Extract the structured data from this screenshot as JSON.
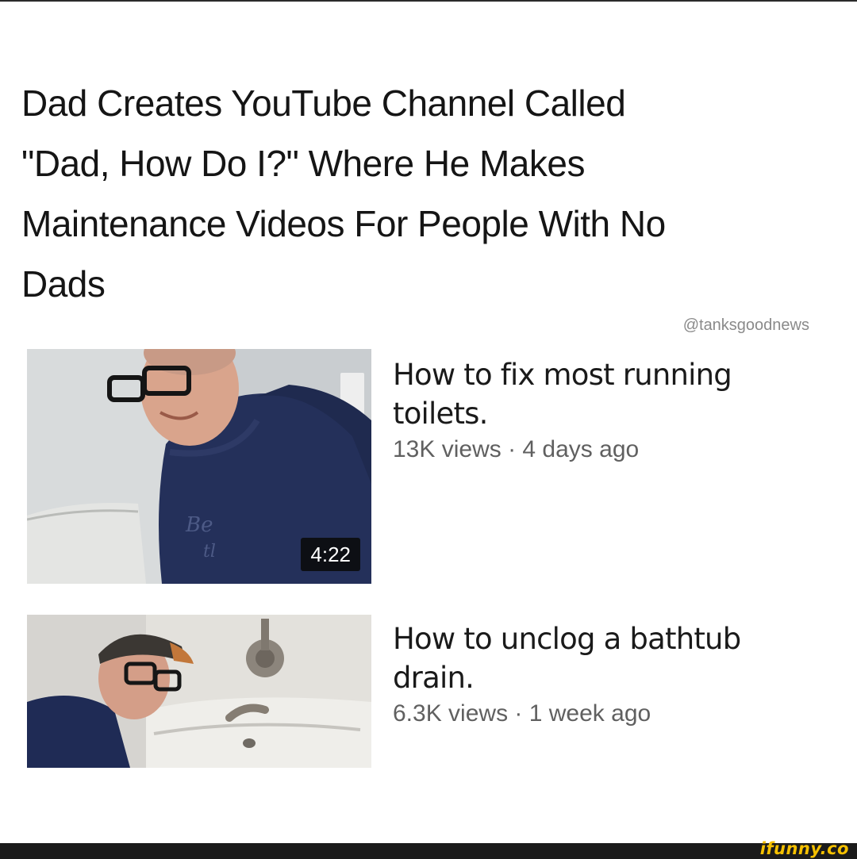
{
  "headline": {
    "line1": "Dad Creates YouTube Channel Called",
    "line2": "\"Dad, How Do I?\" Where He Makes",
    "line3": "Maintenance Videos For People With No",
    "line4": "Dads"
  },
  "credit": "@tanksgoodnews",
  "videos": [
    {
      "title_line1": "How to fix most running",
      "title_line2": "toilets.",
      "views": "13K views",
      "separator": " · ",
      "age": "4 days ago",
      "duration": "4:22"
    },
    {
      "title_line1": "How to unclog a bathtub",
      "title_line2": "drain.",
      "views": "6.3K views",
      "separator": " · ",
      "age": "1 week ago"
    }
  ],
  "watermark": "ifunny.co",
  "colors": {
    "background": "#ffffff",
    "text": "#151515",
    "meta_text": "#606060",
    "watermark": "#f5c000",
    "footer": "#1b1b1b"
  }
}
